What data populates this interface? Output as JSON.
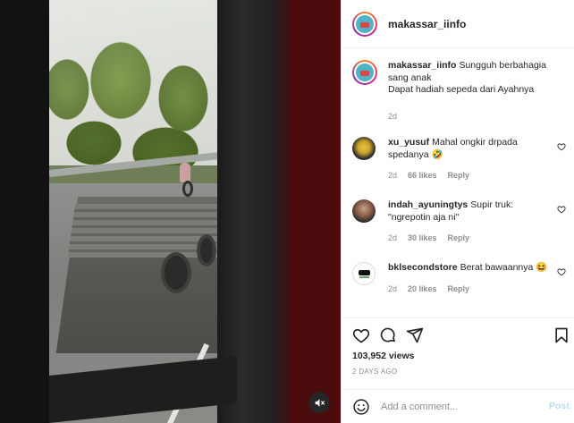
{
  "post": {
    "username": "makassar_iinfo",
    "views": "103,952 views",
    "posted": "2 DAYS AGO"
  },
  "caption": {
    "username": "makassar_iinfo",
    "line1": "Sungguh berbahagia sang anak",
    "line2": "Dapat hadiah sepeda dari Ayahnya",
    "time": "2d"
  },
  "comments": [
    {
      "username": "xu_yusuf",
      "text": "Mahal ongkir drpada spedanya 🤣",
      "time": "2d",
      "likes": "66 likes",
      "reply": "Reply"
    },
    {
      "username": "indah_ayuningtys",
      "text": "Supir truk: \"ngrepotin aja ni\"",
      "time": "2d",
      "likes": "30 likes",
      "reply": "Reply"
    },
    {
      "username": "bklsecondstore",
      "text": "Berat bawaannya 😆",
      "time": "2d",
      "likes": "20 likes",
      "reply": "Reply"
    }
  ],
  "add_comment": {
    "placeholder": "Add a comment...",
    "post_label": "Post"
  },
  "icons": {
    "like": "heart-icon",
    "comment": "comment-icon",
    "share": "share-icon",
    "save": "bookmark-icon",
    "emoji": "emoji-icon",
    "mute": "speaker-muted-icon"
  },
  "colors": {
    "text": "#262626",
    "muted": "#8e8e8e",
    "post_button": "#b2dffc",
    "divider": "#efefef"
  }
}
